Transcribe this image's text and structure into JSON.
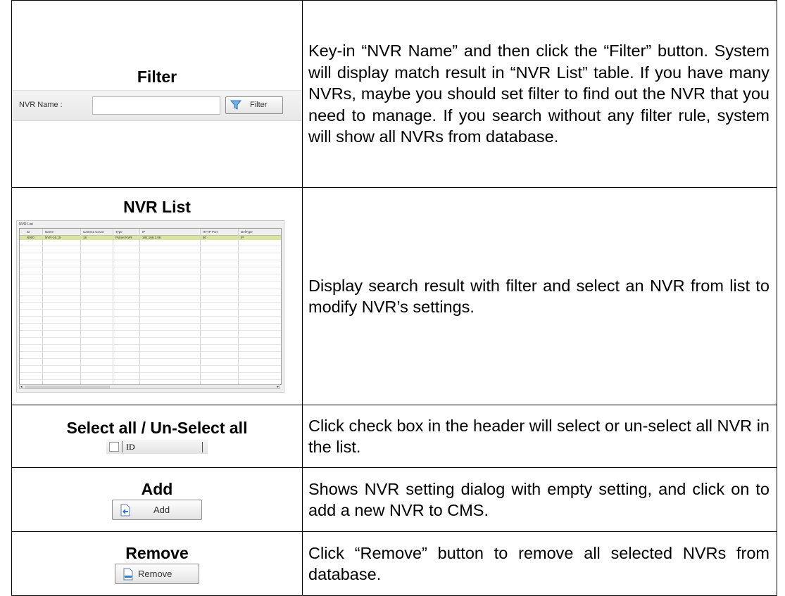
{
  "rows": [
    {
      "heading": "Filter",
      "description": "Key-in “NVR Name” and then click the “Filter” button. System will display match result in “NVR List” table. If you have many NVRs, maybe you should set filter to find out the NVR that you need to manage. If you search without any filter rule, system will show all NVRs from database.",
      "ui": {
        "label": "NVR Name :",
        "button": "Filter",
        "icon": "filter-funnel-icon"
      }
    },
    {
      "heading": "NVR List",
      "description": "Display search result with filter and select an NVR from list to modify NVR’s settings.",
      "ui": {
        "caption": "NVR List",
        "columns": [
          "ID",
          "Name",
          "Camera Count",
          "Type",
          "IP",
          "HTTP Port",
          "DefType"
        ],
        "selected_row": [
          "N000",
          "NVR-16.15",
          "16",
          "Planet NVR",
          "192.168.1.96",
          "80",
          "IP"
        ]
      }
    },
    {
      "heading": "Select all / Un-Select all",
      "description": "Click check box in the header will select or un-select all NVR in the list.",
      "ui": {
        "header_label": "ID"
      }
    },
    {
      "heading": "Add",
      "description": "Shows NVR setting dialog with empty setting, and click on to add a new NVR to CMS.",
      "ui": {
        "button": "Add",
        "icon": "add-document-icon"
      }
    },
    {
      "heading": "Remove",
      "description": "Click “Remove” button to remove all selected NVRs from database.",
      "ui": {
        "button": "Remove",
        "icon": "remove-document-icon"
      }
    }
  ]
}
